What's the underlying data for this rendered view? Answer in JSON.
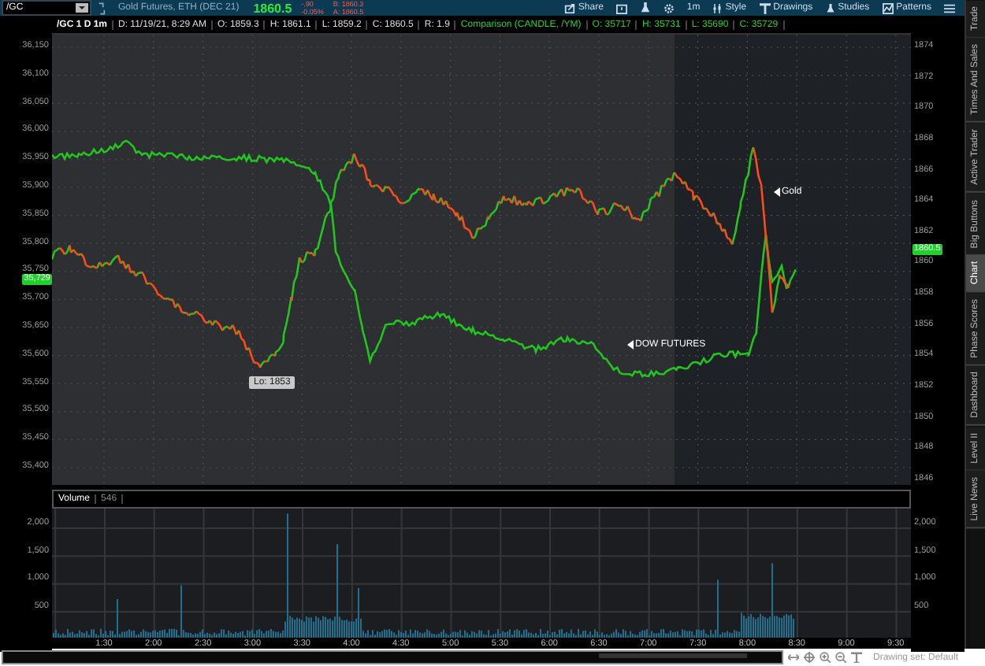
{
  "toolbar": {
    "symbol": "/GC",
    "description": "Gold Futures, ETH (DEC 21)",
    "last": "1860.5",
    "change": "-.90",
    "change_pct": "-0.05%",
    "bid": "B: 1860.3",
    "ask": "A: 1860.5",
    "buttons": [
      {
        "label": "Share"
      },
      {
        "label": "1m"
      },
      {
        "label": "Style"
      },
      {
        "label": "Drawings"
      },
      {
        "label": "Studies"
      },
      {
        "label": "Patterns"
      }
    ]
  },
  "info_bar": {
    "title": "/GC 1 D 1m",
    "fields": [
      "D: 11/19/21, 8:29 AM",
      "O: 1859.3",
      "H: 1861.1",
      "L: 1859.2",
      "C: 1860.5",
      "R: 1.9"
    ],
    "comparison": "Comparison (CANDLE, /YM)",
    "comparison_fields": [
      "O: 35717",
      "H: 35731",
      "L: 35690",
      "C: 35729"
    ]
  },
  "price_chart": {
    "left_axis": [
      "36,150",
      "36,100",
      "36,050",
      "36,000",
      "35,950",
      "35,900",
      "35,850",
      "35,800",
      "35,750",
      "35,700",
      "35,650",
      "35,600",
      "35,550",
      "35,500",
      "35,450",
      "35,400"
    ],
    "right_axis": [
      "1874",
      "1872",
      "1870",
      "1868",
      "1866",
      "1864",
      "1862",
      "1860",
      "1858",
      "1856",
      "1854",
      "1852",
      "1850",
      "1848",
      "1846"
    ],
    "left_badge": "35,729",
    "right_badge": "1860.5",
    "annotations": [
      {
        "kind": "box",
        "text": "Lo: 1853"
      },
      {
        "kind": "arrow",
        "text": "Gold"
      },
      {
        "kind": "arrow",
        "text": "DOW FUTURES"
      }
    ]
  },
  "volume": {
    "title": "Volume",
    "value": "546",
    "left_axis": [
      "2,000",
      "1,500",
      "1,000",
      "500"
    ],
    "right_axis": [
      "2,000",
      "1,500",
      "1,000",
      "500"
    ]
  },
  "time_axis": [
    "1:30",
    "2:00",
    "2:30",
    "3:00",
    "3:30",
    "4:00",
    "4:30",
    "5:00",
    "5:30",
    "6:00",
    "6:30",
    "7:00",
    "7:30",
    "8:00",
    "8:30",
    "9:00",
    "9:30"
  ],
  "sidebar_tabs": [
    {
      "label": "Trade",
      "selected": false
    },
    {
      "label": "Times And Sales",
      "selected": false
    },
    {
      "label": "Active Trader",
      "selected": false
    },
    {
      "label": "Big Buttons",
      "selected": false
    },
    {
      "label": "Chart",
      "selected": true
    },
    {
      "label": "Phase Scores",
      "selected": false
    },
    {
      "label": "Dashboard",
      "selected": false
    },
    {
      "label": "Level II",
      "selected": false
    },
    {
      "label": "Live News",
      "selected": false
    }
  ],
  "status_bar": {
    "drawing_set": "Drawing set: Default"
  }
}
